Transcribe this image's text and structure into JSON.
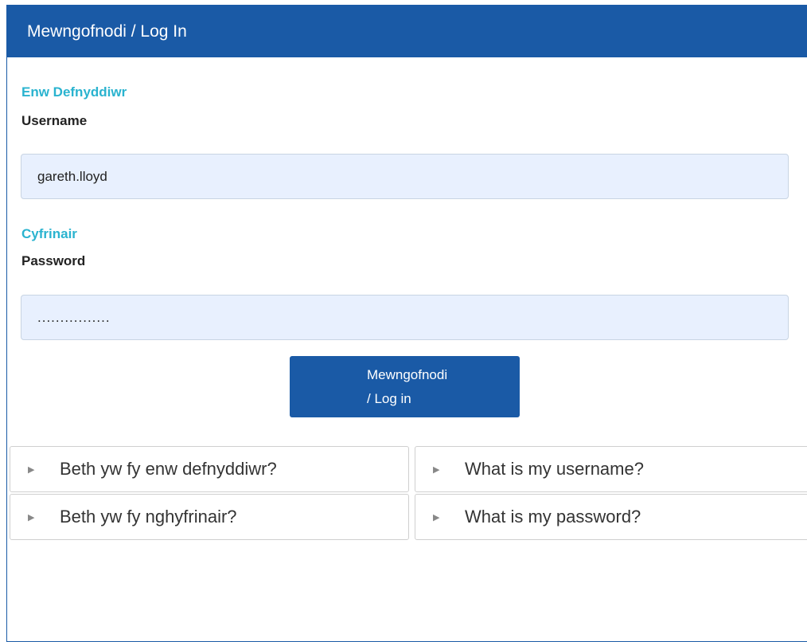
{
  "header": {
    "title": "Mewngofnodi / Log In"
  },
  "username": {
    "label_cy": "Enw Defnyddiwr",
    "label_en": "Username",
    "value": "gareth.lloyd"
  },
  "password": {
    "label_cy": "Cyfrinair",
    "label_en": "Password",
    "value": "................"
  },
  "login_button": {
    "line1": "Mewngofnodi",
    "line2": "/ Log in"
  },
  "help": {
    "username_cy": "Beth yw fy enw defnyddiwr?",
    "username_en": "What is my username?",
    "password_cy": "Beth yw fy nghyfrinair?",
    "password_en": "What is my password?"
  },
  "colors": {
    "primary": "#1a5aa6",
    "label_welsh": "#2ab3cf",
    "input_bg": "#e8f0fe"
  },
  "icons": {
    "expand": "caret-right-icon"
  }
}
